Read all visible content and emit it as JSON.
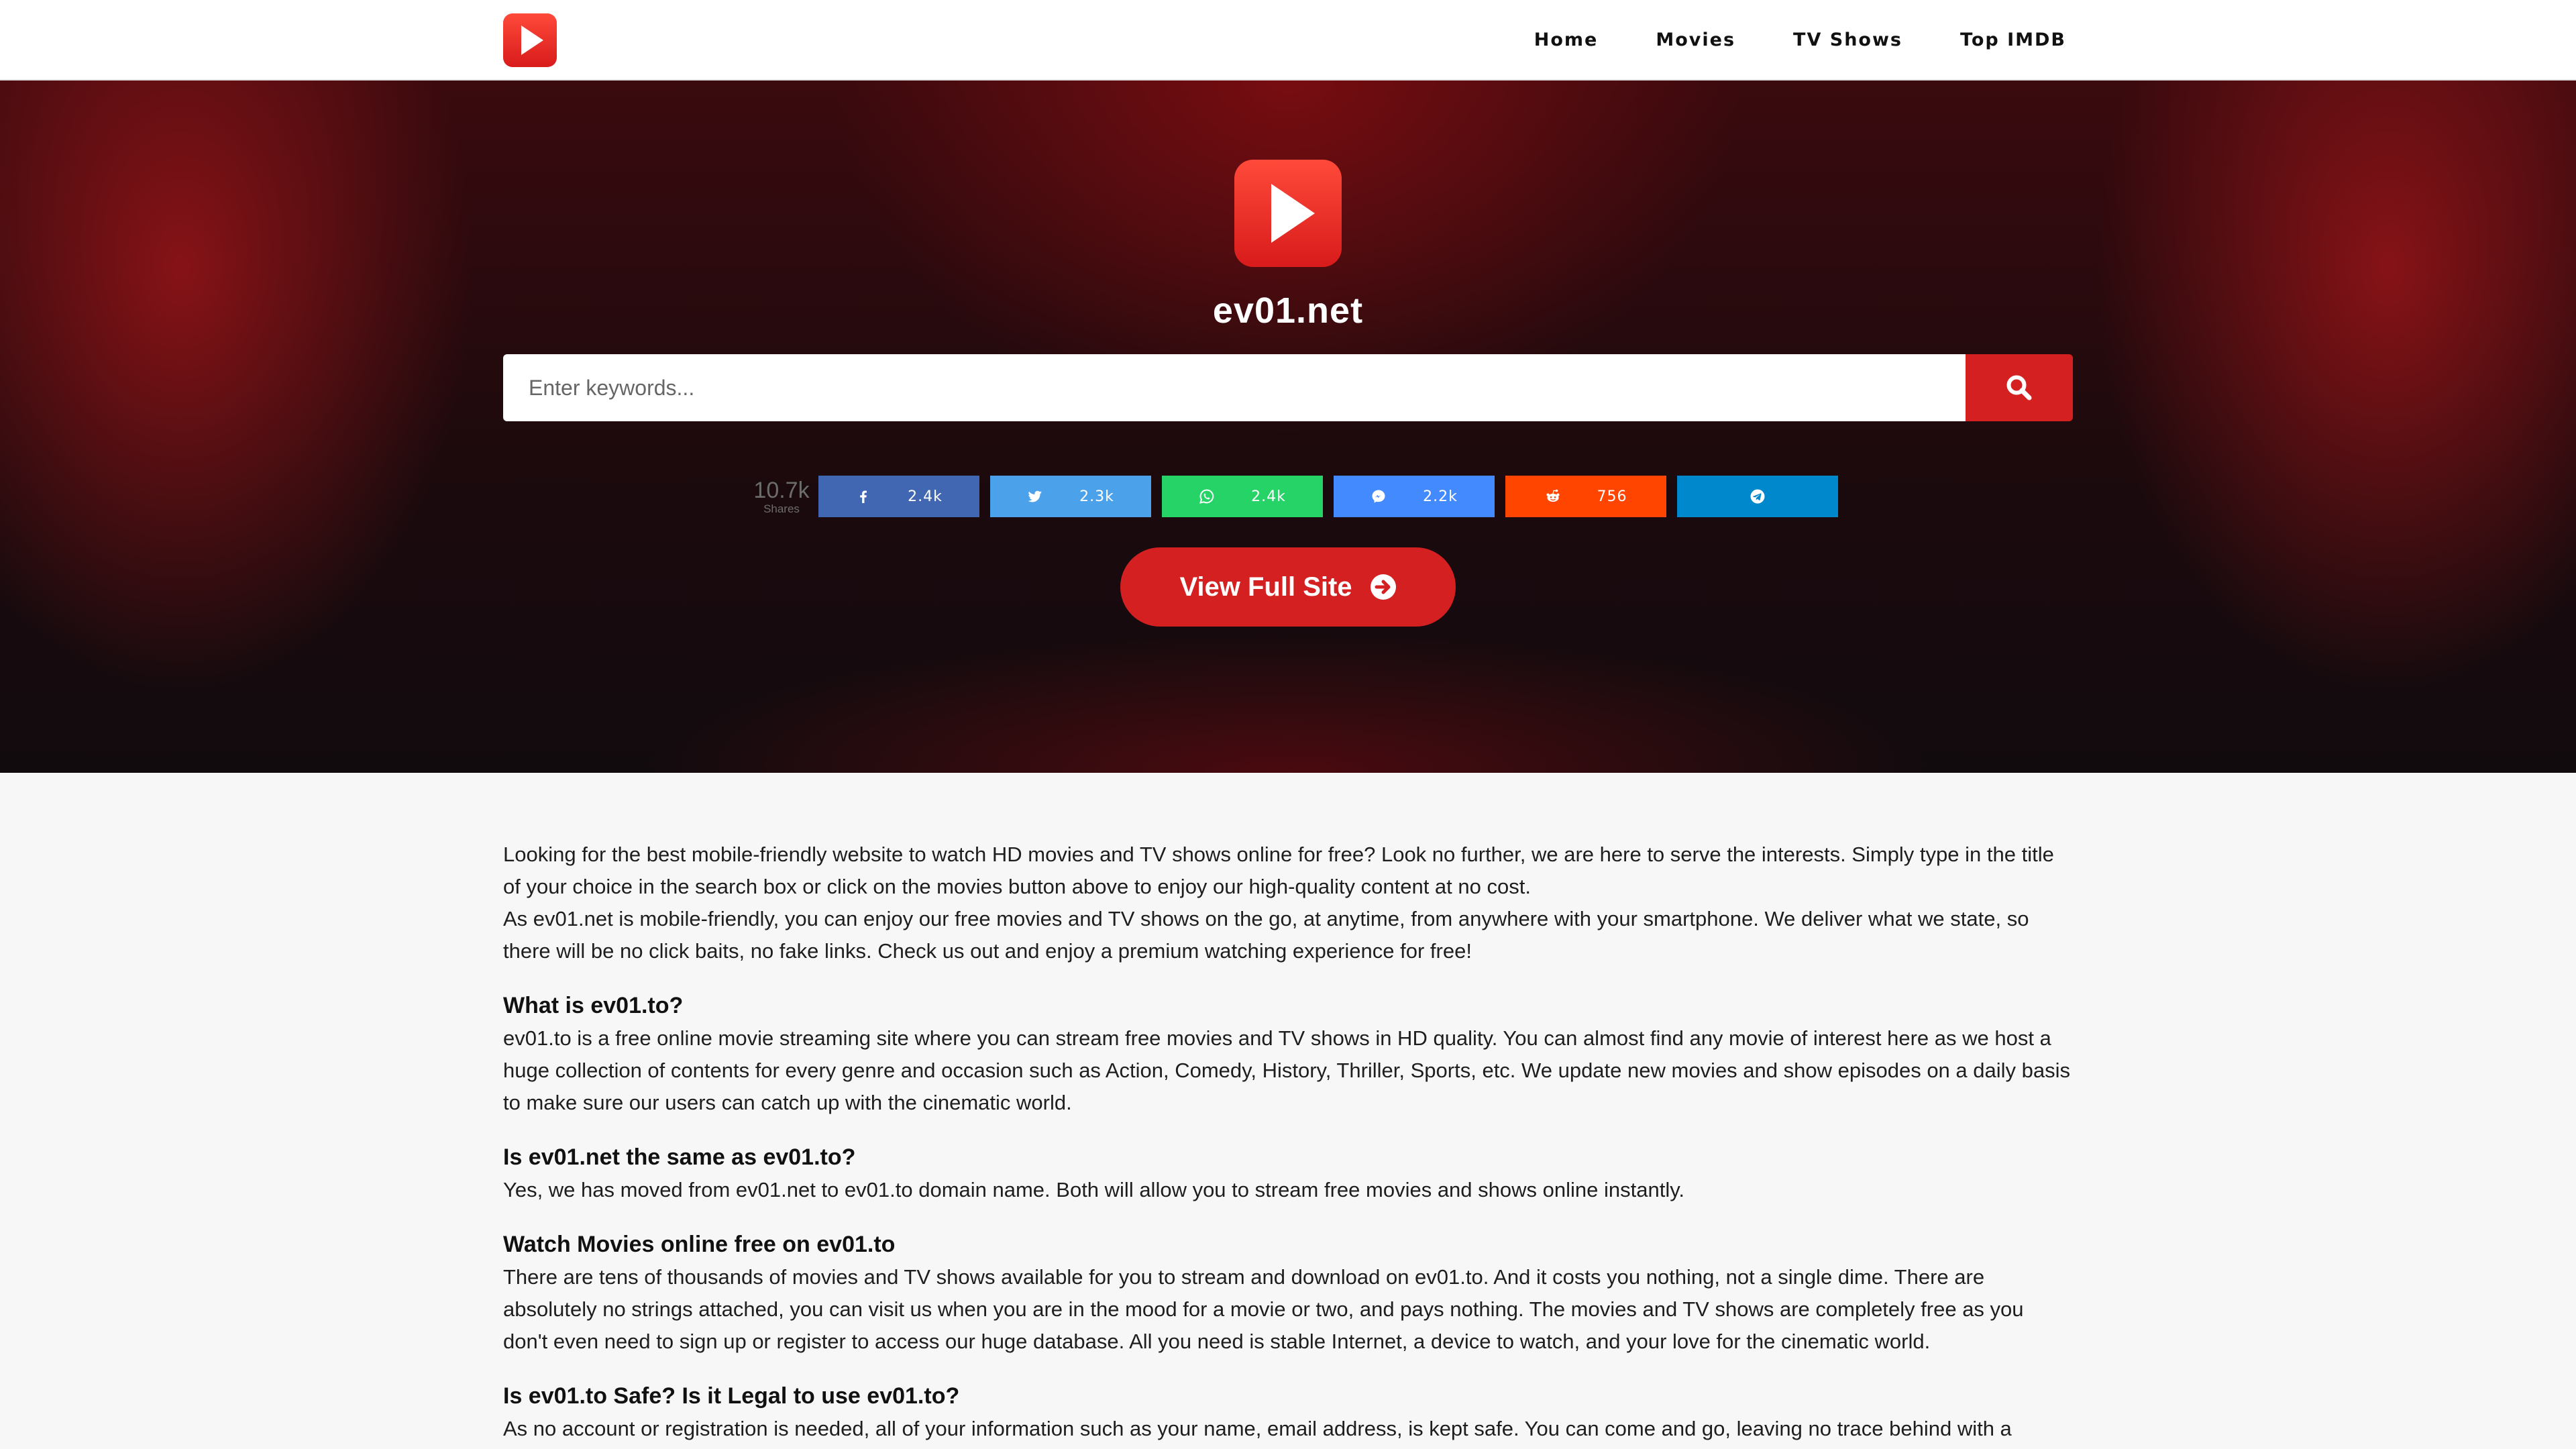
{
  "header": {
    "logo": "play-icon",
    "nav": [
      "Home",
      "Movies",
      "TV Shows",
      "Top IMDB"
    ]
  },
  "hero": {
    "site_name": "ev01.net",
    "search": {
      "placeholder": "Enter keywords...",
      "button_icon": "search-icon"
    },
    "share": {
      "total_count": "10.7k",
      "total_label": "Shares",
      "buttons": [
        {
          "network": "facebook",
          "icon": "facebook-icon",
          "count": "2.4k",
          "color": "#4267b2"
        },
        {
          "network": "twitter",
          "icon": "twitter-icon",
          "count": "2.3k",
          "color": "#4ca1eb"
        },
        {
          "network": "whatsapp",
          "icon": "whatsapp-icon",
          "count": "2.4k",
          "color": "#25d366"
        },
        {
          "network": "messenger",
          "icon": "messenger-icon",
          "count": "2.2k",
          "color": "#448aff"
        },
        {
          "network": "reddit",
          "icon": "reddit-icon",
          "count": "756",
          "color": "#ff4500"
        },
        {
          "network": "telegram",
          "icon": "telegram-icon",
          "count": "",
          "color": "#0088cc"
        }
      ]
    },
    "view_full_site": "View Full Site"
  },
  "colors": {
    "accent": "#d42020"
  },
  "content": {
    "intro": [
      "Looking for the best mobile-friendly website to watch HD movies and TV shows online for free? Look no further, we are here to serve the interests. Simply type in the title of your choice in the search box or click on the movies button above to enjoy our high-quality content at no cost.",
      "As ev01.net is mobile-friendly, you can enjoy our free movies and TV shows on the go, at anytime, from anywhere with your smartphone. We deliver what we state, so there will be no click baits, no fake links. Check us out and enjoy a premium watching experience for free!"
    ],
    "sections": [
      {
        "heading": "What is ev01.to?",
        "body": "ev01.to is a free online movie streaming site where you can stream free movies and TV shows in HD quality. You can almost find any movie of interest here as we host a huge collection of contents for every genre and occasion such as Action, Comedy, History, Thriller, Sports, etc. We update new movies and show episodes on a daily basis to make sure our users can catch up with the cinematic world."
      },
      {
        "heading": "Is ev01.net the same as ev01.to?",
        "body": "Yes, we has moved from ev01.net to ev01.to domain name. Both will allow you to stream free movies and shows online instantly."
      },
      {
        "heading": "Watch Movies online free on ev01.to",
        "body": "There are tens of thousands of movies and TV shows available for you to stream and download on ev01.to. And it costs you nothing, not a single dime. There are absolutely no strings attached, you can visit us when you are in the mood for a movie or two, and pays nothing. The movies and TV shows are completely free as you don't even need to sign up or register to access our huge database. All you need is stable Internet, a device to watch, and your love for the cinematic world."
      },
      {
        "heading": "Is ev01.to Safe? Is it Legal to use ev01.to?",
        "body": "As no account or registration is needed, all of your information such as your name, email address, is kept safe. You can come and go, leaving no trace behind with a"
      }
    ]
  }
}
